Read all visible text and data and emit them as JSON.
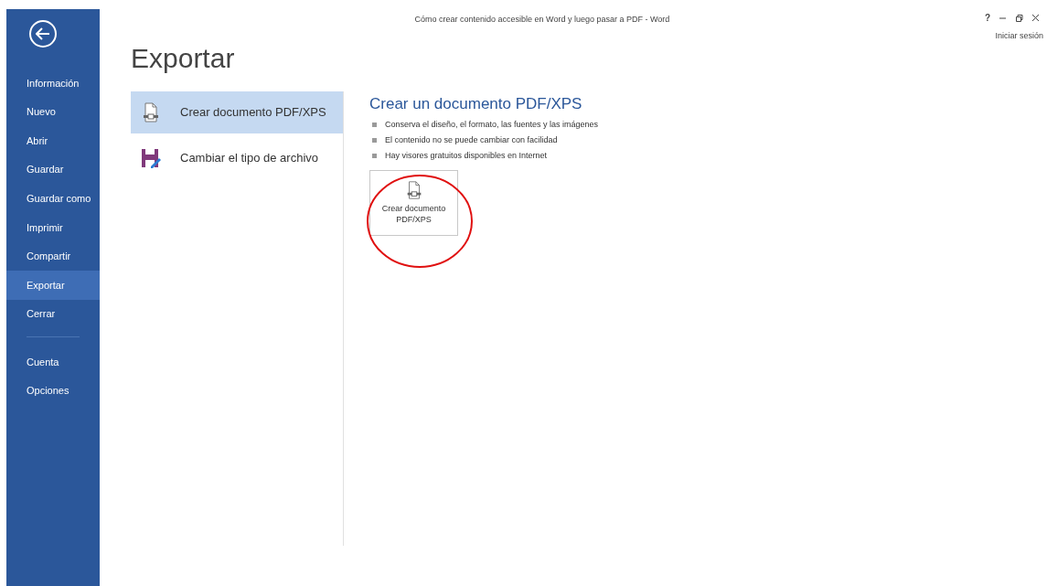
{
  "window": {
    "title": "Cómo crear contenido accesible en Word y luego pasar a PDF - Word",
    "controls": [
      "?"
    ],
    "account": "Iniciar sesión"
  },
  "nav": {
    "items": [
      {
        "label": "Información",
        "selected": false
      },
      {
        "label": "Nuevo",
        "selected": false
      },
      {
        "label": "Abrir",
        "selected": false
      },
      {
        "label": "Guardar",
        "selected": false
      },
      {
        "label": "Guardar como",
        "selected": false
      },
      {
        "label": "Imprimir",
        "selected": false
      },
      {
        "label": "Compartir",
        "selected": false
      },
      {
        "label": "Exportar",
        "selected": true
      },
      {
        "label": "Cerrar",
        "selected": false
      }
    ],
    "bottom_items": [
      {
        "label": "Cuenta",
        "selected": false
      },
      {
        "label": "Opciones",
        "selected": false
      }
    ]
  },
  "page_title": "Exportar",
  "export_options": [
    {
      "kind": "pdf",
      "label": "Crear documento PDF/XPS",
      "selected": true
    },
    {
      "kind": "filetype",
      "label": "Cambiar el tipo de archivo",
      "selected": false
    }
  ],
  "detail": {
    "heading": "Crear un documento PDF/XPS",
    "bullets": [
      "Conserva el diseño, el formato, las fuentes y las imágenes",
      "El contenido no se puede cambiar con facilidad",
      "Hay visores gratuitos disponibles en Internet"
    ],
    "button_lines": [
      "Crear documento",
      "PDF/XPS"
    ]
  }
}
